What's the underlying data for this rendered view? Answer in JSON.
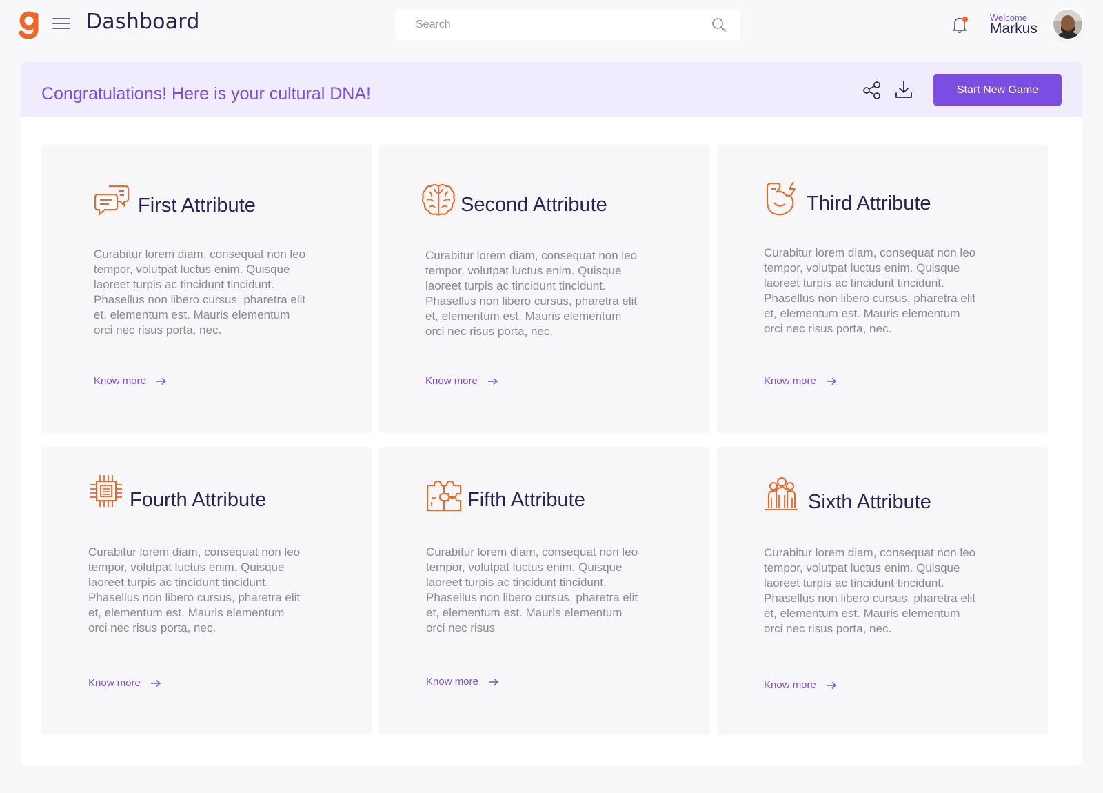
{
  "header": {
    "title": "Dashboard",
    "search_placeholder": "Search",
    "welcome_label": "Welcome",
    "user_name": "Markus"
  },
  "banner": {
    "title": "Congratulations! Here is your cultural DNA!",
    "start_button": "Start New Game"
  },
  "colors": {
    "accent": "#7b4de3",
    "icon_orange": "#f26522",
    "banner_bg": "#f0ecfd"
  },
  "cards": [
    {
      "icon": "chat-bubbles-icon",
      "title": "First Attribute",
      "body": "Curabitur lorem diam, consequat non leo tempor, volutpat luctus enim. Quisque laoreet turpis ac tincidunt tincidunt. Phasellus non libero cursus, pharetra elit et, elementum est. Mauris elementum orci nec risus porta, nec.",
      "link": "Know more"
    },
    {
      "icon": "brain-icon",
      "title": "Second Attribute",
      "body": "Curabitur lorem diam, consequat non leo tempor, volutpat luctus enim. Quisque laoreet turpis ac tincidunt tincidunt. Phasellus non libero cursus, pharetra elit et, elementum est. Mauris elementum orci nec risus porta, nec.",
      "link": "Know more"
    },
    {
      "icon": "strength-arm-icon",
      "title": "Third Attribute",
      "body": "Curabitur lorem diam, consequat non leo tempor, volutpat luctus enim. Quisque laoreet turpis ac tincidunt tincidunt. Phasellus non libero cursus, pharetra elit et, elementum est. Mauris elementum orci nec risus porta, nec.",
      "link": "Know more"
    },
    {
      "icon": "cpu-chip-icon",
      "title": "Fourth Attribute",
      "body": "Curabitur lorem diam, consequat non leo tempor, volutpat luctus enim. Quisque laoreet turpis ac tincidunt tincidunt. Phasellus non libero cursus, pharetra elit et, elementum est. Mauris elementum orci nec risus porta, nec.",
      "link": "Know more"
    },
    {
      "icon": "puzzle-icon",
      "title": "Fifth Attribute",
      "body": "Curabitur lorem diam, consequat non leo tempor, volutpat luctus enim. Quisque laoreet turpis ac tincidunt tincidunt. Phasellus non libero cursus, pharetra elit et, elementum est. Mauris elementum orci nec risus",
      "link": "Know more"
    },
    {
      "icon": "team-people-icon",
      "title": "Sixth Attribute",
      "body": "Curabitur lorem diam, consequat non leo tempor, volutpat luctus enim. Quisque laoreet turpis ac tincidunt tincidunt. Phasellus non libero cursus, pharetra elit et, elementum est. Mauris elementum orci nec risus porta, nec.",
      "link": "Know more"
    }
  ]
}
